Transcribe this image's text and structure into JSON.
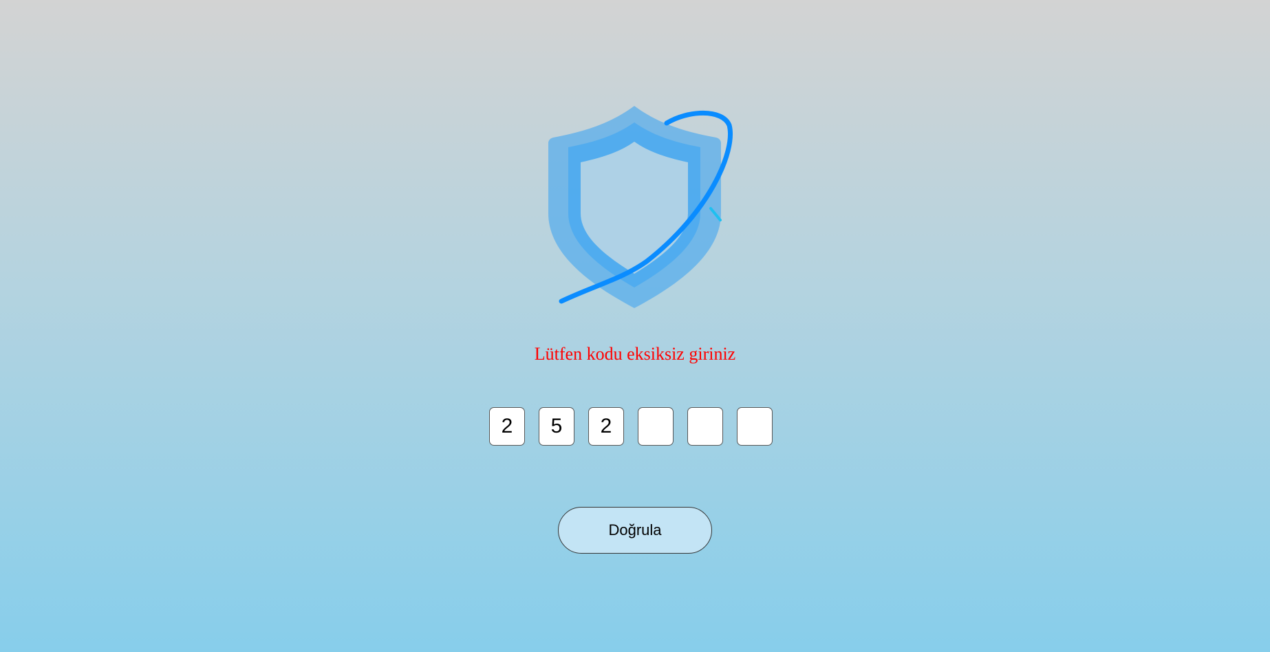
{
  "logo": {
    "icon": "shield-icon",
    "colors": {
      "shield": "#4aa8ee",
      "swoosh": "#0a8cff",
      "accent": "#1ec0f0"
    }
  },
  "message": {
    "text": "Lütfen kodu eksiksiz giriniz",
    "color": "#ff0000"
  },
  "otp": {
    "digits": [
      "2",
      "5",
      "2",
      "",
      "",
      ""
    ]
  },
  "verify_button": {
    "label": "Doğrula",
    "background": "#c3e4f5"
  }
}
